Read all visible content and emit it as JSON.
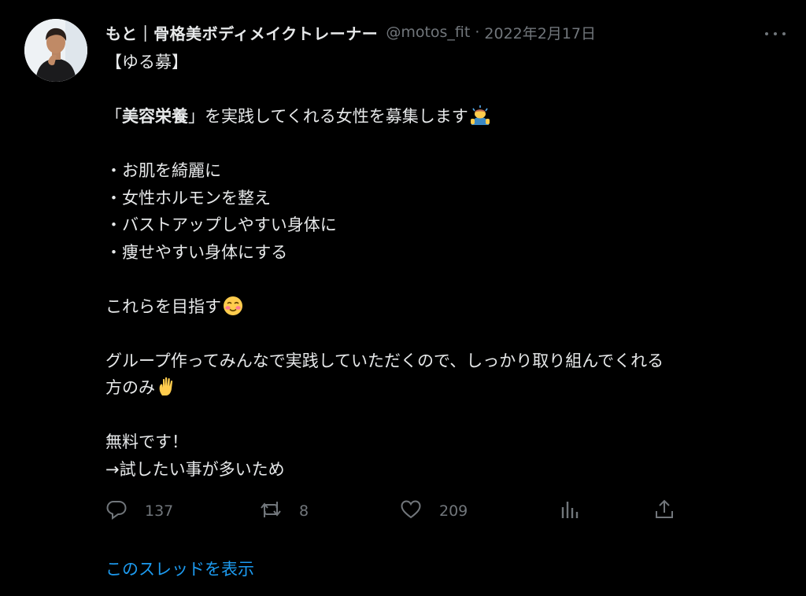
{
  "author": {
    "display_name": "もと｜骨格美ボディメイクトレーナー",
    "handle": "@motos_fit",
    "separator": "·",
    "date": "2022年2月17日"
  },
  "tweet": {
    "title": "【ゆる募】",
    "intro_open": "「",
    "intro_strong": "美容栄養",
    "intro_close": "」",
    "intro_rest": "を実践してくれる女性を募集します",
    "bullets": [
      "・お肌を綺麗に",
      "・女性ホルモンを整え",
      "・バストアップしやすい身体に",
      "・痩せやすい身体にする"
    ],
    "goal": "これらを目指す",
    "group_line1": "グループ作ってみんなで実践していただくので、しっかり取り組んでくれる",
    "group_line2": "方のみ",
    "free": "無料です！",
    "reason": "→試したい事が多いため"
  },
  "actions": {
    "replies": "137",
    "retweets": "8",
    "likes": "209"
  },
  "thread_link": "このスレッドを表示",
  "icons": {
    "reply": "reply-icon",
    "retweet": "retweet-icon",
    "like": "heart-icon",
    "analytics": "analytics-icon",
    "share": "share-icon",
    "more": "more-icon"
  },
  "colors": {
    "background": "#000000",
    "text": "#e7e9ea",
    "secondary": "#71767b",
    "link": "#1d9bf0"
  }
}
